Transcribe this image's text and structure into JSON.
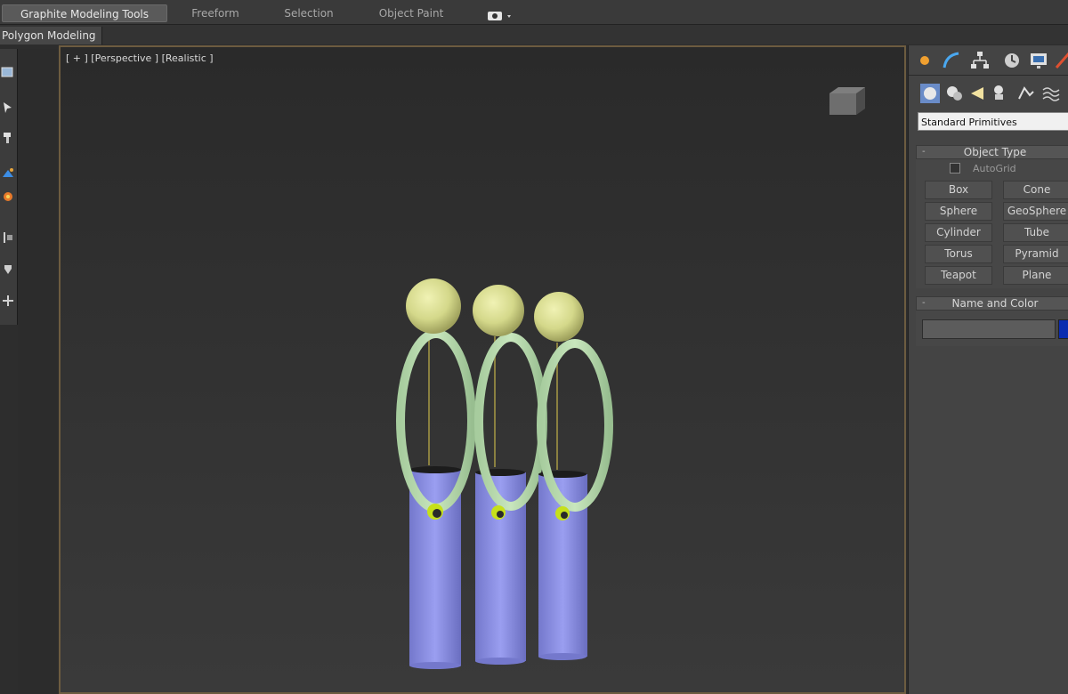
{
  "ribbon": {
    "tabs": [
      {
        "label": "Graphite Modeling Tools",
        "active": true
      },
      {
        "label": "Freeform",
        "active": false
      },
      {
        "label": "Selection",
        "active": false
      },
      {
        "label": "Object Paint",
        "active": false
      }
    ],
    "options_icon": "camera-dropdown-icon",
    "subtab": "Polygon Modeling"
  },
  "left_toolbar": {
    "icons": [
      "viewport-tool-icon",
      "arrow-tool-icon",
      "paint-tool-icon",
      "transform-gizmo-icon",
      "light-icon",
      "align-tool-icon",
      "snap-tool-icon",
      "pivot-tool-icon"
    ]
  },
  "viewport": {
    "label": "[ + ] [Perspective ] [Realistic ]",
    "navigation_icon": "viewcube-icon",
    "border_color": "#6d5c40",
    "scene_objects": [
      {
        "type": "sphere",
        "color": "#d8dc8c"
      },
      {
        "type": "torus-ring",
        "color": "#b8dcb0"
      },
      {
        "type": "cylinder",
        "color": "#8c8ce4"
      }
    ],
    "figure_count": 3
  },
  "command_panel": {
    "tab_icons": [
      "create-tab-icon",
      "modify-tab-icon",
      "hierarchy-tab-icon",
      "motion-tab-icon",
      "display-tab-icon",
      "utilities-tab-icon"
    ],
    "category_icons": [
      "geometry-icon",
      "shapes-icon",
      "lights-icon",
      "cameras-icon",
      "helpers-icon",
      "spacewarps-icon"
    ],
    "dropdown": "Standard Primitives",
    "object_type": {
      "title": "Object Type",
      "autogrid": "AutoGrid",
      "buttons": [
        "Box",
        "Cone",
        "Sphere",
        "GeoSphere",
        "Cylinder",
        "Tube",
        "Torus",
        "Pyramid",
        "Teapot",
        "Plane"
      ]
    },
    "name_and_color": {
      "title": "Name and Color",
      "name_value": "",
      "swatch_color": "#0b2bb0"
    }
  }
}
